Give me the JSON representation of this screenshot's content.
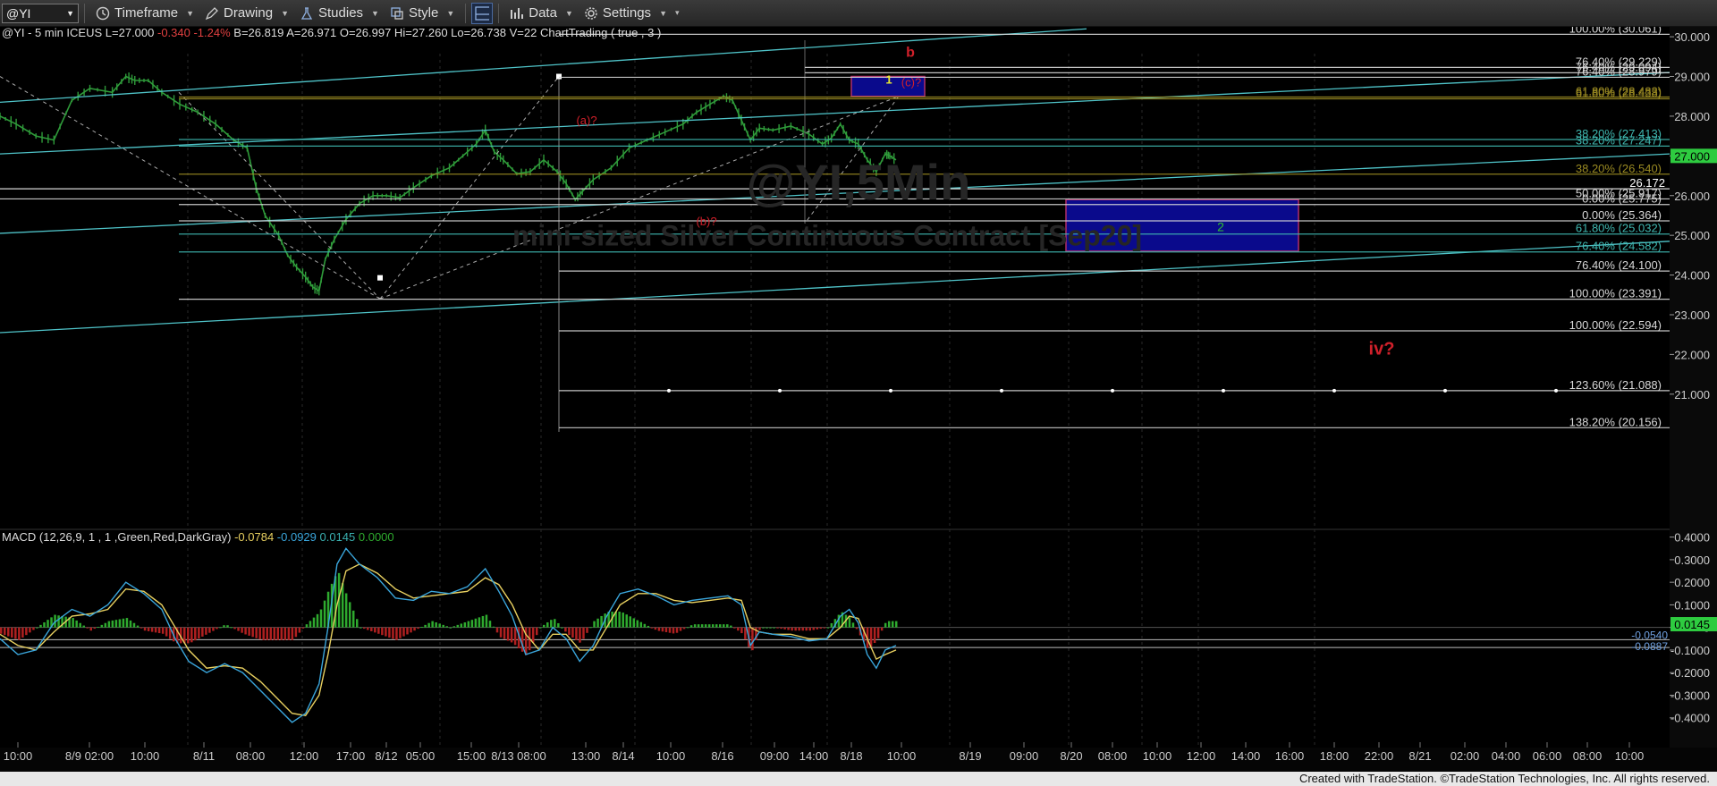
{
  "toolbar": {
    "symbol": "@YI",
    "items": [
      {
        "label": "Timeframe",
        "icon": "clock-icon"
      },
      {
        "label": "Drawing",
        "icon": "pencil-icon"
      },
      {
        "label": "Studies",
        "icon": "flask-icon"
      },
      {
        "label": "Style",
        "icon": "style-icon"
      },
      {
        "label": "Data",
        "icon": "bar-chart-icon"
      },
      {
        "label": "Settings",
        "icon": "gear-icon"
      }
    ]
  },
  "colors": {
    "background": "#000000",
    "price": "#2f9b3a",
    "fib_white": "#d8d8d8",
    "fib_teal": "#3fb7b0",
    "fib_yellow": "#9a8a22",
    "channel": "#4fc3c8",
    "box_fill": "#0a0a8c",
    "box_border": "#b0306a",
    "wave_label": "#d0202a",
    "yellow_label": "#e8e830",
    "green_label": "#30c030",
    "macd": "#3aa6dc",
    "signal": "#e8d060",
    "hist_up": "#2eaa2e",
    "hist_down": "#b02020"
  },
  "header": {
    "symbol_info": "@YI - 5 min  ICEUS",
    "last": "L=27.000",
    "change": "-0.340",
    "change_pct": "-1.24%",
    "bid": "B=26.819",
    "ask": "A=26.971",
    "open": "O=26.997",
    "high": "Hi=27.260",
    "low": "Lo=26.738",
    "volume": "V=22",
    "strategy": "ChartTrading ( true , 3 )"
  },
  "watermark": {
    "symbol": "@YI,5Min",
    "description": "mini-sized Silver Continuous Contract [Sep20]"
  },
  "price_tag": "27.000",
  "level_26172": "26.172",
  "macd_header": {
    "label": "MACD (12,26,9, 1 , 1 ,Green,Red,DarkGray)",
    "v1": "-0.0784",
    "v2": "-0.0929",
    "v3": "0.0145",
    "v4": "0.0000"
  },
  "macd_tag": "0.0145",
  "macd_lines": [
    "-0.0540",
    "-0.0887"
  ],
  "footer": "Created with TradeStation. ©TradeStation Technologies, Inc. All rights reserved.",
  "chart_data": {
    "type": "line",
    "title": "@YI - 5 min ICEUS",
    "ylim": [
      20.05,
      30.25
    ],
    "price_ticks": [
      30,
      29,
      28,
      27,
      26,
      25,
      24,
      23,
      22,
      21
    ],
    "price_tick_labels": [
      "30.000",
      "29.000",
      "28.000",
      "27.000",
      "26.000",
      "25.000",
      "24.000",
      "23.000",
      "22.000",
      "21.000"
    ],
    "x_tick_labels": [
      "10:00",
      "8/9 02:00",
      "10:00",
      "8/11",
      "08:00",
      "12:00",
      "17:00",
      "8/12",
      "05:00",
      "15:00",
      "8/13 08:00",
      "13:00",
      "8/14",
      "10:00",
      "8/16",
      "09:00",
      "14:00",
      "8/18",
      "10:00",
      "8/19",
      "09:00",
      "8/20",
      "08:00",
      "10:00",
      "12:00",
      "14:00",
      "16:00",
      "18:00",
      "22:00",
      "8/21",
      "02:00",
      "04:00",
      "06:00",
      "08:00",
      "10:00"
    ],
    "series": [
      {
        "values": [
          [
            0,
            28.0
          ],
          [
            18,
            27.8
          ],
          [
            40,
            27.5
          ],
          [
            60,
            27.4
          ],
          [
            80,
            28.4
          ],
          [
            100,
            28.7
          ],
          [
            125,
            28.6
          ],
          [
            140,
            29.0
          ],
          [
            150,
            28.9
          ],
          [
            165,
            28.9
          ],
          [
            180,
            28.6
          ],
          [
            200,
            28.3
          ],
          [
            220,
            28.1
          ],
          [
            240,
            27.8
          ],
          [
            260,
            27.4
          ],
          [
            275,
            27.2
          ],
          [
            285,
            26.2
          ],
          [
            295,
            25.5
          ],
          [
            310,
            25.0
          ],
          [
            320,
            24.5
          ],
          [
            330,
            24.2
          ],
          [
            340,
            23.95
          ],
          [
            348,
            23.7
          ],
          [
            355,
            23.6
          ],
          [
            362,
            24.4
          ],
          [
            372,
            24.9
          ],
          [
            385,
            25.4
          ],
          [
            400,
            25.8
          ],
          [
            415,
            26.0
          ],
          [
            430,
            26.0
          ],
          [
            445,
            25.95
          ],
          [
            460,
            26.2
          ],
          [
            480,
            26.5
          ],
          [
            500,
            26.7
          ],
          [
            515,
            27.0
          ],
          [
            530,
            27.3
          ],
          [
            540,
            27.65
          ],
          [
            550,
            27.1
          ],
          [
            560,
            26.9
          ],
          [
            575,
            26.55
          ],
          [
            590,
            26.6
          ],
          [
            605,
            26.9
          ],
          [
            620,
            26.6
          ],
          [
            630,
            26.3
          ],
          [
            640,
            25.9
          ],
          [
            648,
            26.1
          ],
          [
            660,
            26.4
          ],
          [
            680,
            26.7
          ],
          [
            700,
            27.2
          ],
          [
            720,
            27.4
          ],
          [
            740,
            27.6
          ],
          [
            760,
            27.8
          ],
          [
            775,
            28.1
          ],
          [
            790,
            28.3
          ],
          [
            805,
            28.5
          ],
          [
            815,
            28.4
          ],
          [
            825,
            27.9
          ],
          [
            835,
            27.4
          ],
          [
            845,
            27.7
          ],
          [
            860,
            27.65
          ],
          [
            880,
            27.75
          ],
          [
            900,
            27.55
          ],
          [
            915,
            27.3
          ],
          [
            925,
            27.45
          ],
          [
            935,
            27.8
          ],
          [
            945,
            27.4
          ],
          [
            955,
            27.3
          ],
          [
            965,
            26.9
          ],
          [
            975,
            26.6
          ],
          [
            985,
            27.05
          ],
          [
            990,
            27.0
          ],
          [
            997,
            26.9
          ]
        ]
      }
    ],
    "fib_levels": [
      {
        "label": "100.00% (30.061)",
        "value": 30.061,
        "color": "#d8d8d8"
      },
      {
        "label": "76.40% (29.229)",
        "value": 29.229,
        "color": "#d8d8d8"
      },
      {
        "label": "76.40% (29.094)",
        "value": 29.094,
        "color": "#d8d8d8"
      },
      {
        "label": "76.40% (28.979)",
        "value": 28.979,
        "color": "#d8d8d8"
      },
      {
        "label": "61.80% (28.483)",
        "value": 28.483,
        "color": "#9a8a22"
      },
      {
        "label": "61.80% (28.438)",
        "value": 28.438,
        "color": "#9a8a22"
      },
      {
        "label": "38.20% (27.413)",
        "value": 27.413,
        "color": "#3fb7b0"
      },
      {
        "label": "38.20% (27.247)",
        "value": 27.247,
        "color": "#3fb7b0"
      },
      {
        "label": "38.20% (26.540)",
        "value": 26.54,
        "color": "#9a8a22"
      },
      {
        "label": "50.00% (25.917)",
        "value": 25.917,
        "color": "#d8d8d8"
      },
      {
        "label": "0.00% (25.775)",
        "value": 25.775,
        "color": "#d8d8d8"
      },
      {
        "label": "0.00% (25.364)",
        "value": 25.364,
        "color": "#d8d8d8"
      },
      {
        "label": "61.80% (25.032)",
        "value": 25.032,
        "color": "#3fb7b0"
      },
      {
        "label": "76.40% (24.582)",
        "value": 24.582,
        "color": "#3fb7b0"
      },
      {
        "label": "76.40% (24.100)",
        "value": 24.1,
        "color": "#d8d8d8"
      },
      {
        "label": "100.00% (23.391)",
        "value": 23.391,
        "color": "#d8d8d8"
      },
      {
        "label": "100.00% (22.594)",
        "value": 22.594,
        "color": "#d8d8d8"
      },
      {
        "label": "123.60% (21.088)",
        "value": 21.088,
        "color": "#d8d8d8"
      },
      {
        "label": "138.20% (20.156)",
        "value": 20.156,
        "color": "#d8d8d8"
      }
    ],
    "wave_labels": [
      {
        "text": "b",
        "color": "#d0202a"
      },
      {
        "text": "1",
        "color": "#e8e830"
      },
      {
        "text": "(c)?",
        "color": "#d0202a"
      },
      {
        "text": "(a)?",
        "color": "#d0202a"
      },
      {
        "text": "(b)?",
        "color": "#d0202a"
      },
      {
        "text": "2",
        "color": "#30c030"
      },
      {
        "text": "iv?",
        "color": "#d0202a"
      }
    ],
    "macd": {
      "ylim": [
        -0.5,
        0.45
      ],
      "ticks": [
        0.4,
        0.3,
        0.2,
        0.1,
        0,
        -0.1,
        -0.2,
        -0.3,
        -0.4
      ],
      "tick_labels": [
        "0.4000",
        "0.3000",
        "0.2000",
        "0.1000",
        "0",
        "-0.1000",
        "-0.2000",
        "-0.3000",
        "-0.4000"
      ],
      "macd_values": [
        [
          0,
          -0.05
        ],
        [
          20,
          -0.12
        ],
        [
          40,
          -0.1
        ],
        [
          60,
          0.02
        ],
        [
          80,
          0.08
        ],
        [
          100,
          0.05
        ],
        [
          120,
          0.1
        ],
        [
          140,
          0.2
        ],
        [
          160,
          0.15
        ],
        [
          180,
          0.08
        ],
        [
          195,
          -0.05
        ],
        [
          210,
          -0.15
        ],
        [
          230,
          -0.2
        ],
        [
          250,
          -0.16
        ],
        [
          270,
          -0.2
        ],
        [
          290,
          -0.28
        ],
        [
          310,
          -0.36
        ],
        [
          325,
          -0.42
        ],
        [
          340,
          -0.38
        ],
        [
          355,
          -0.25
        ],
        [
          365,
          0.0
        ],
        [
          375,
          0.28
        ],
        [
          385,
          0.35
        ],
        [
          400,
          0.28
        ],
        [
          420,
          0.22
        ],
        [
          440,
          0.13
        ],
        [
          460,
          0.12
        ],
        [
          480,
          0.16
        ],
        [
          500,
          0.15
        ],
        [
          520,
          0.18
        ],
        [
          540,
          0.26
        ],
        [
          555,
          0.16
        ],
        [
          570,
          0.05
        ],
        [
          585,
          -0.12
        ],
        [
          600,
          -0.1
        ],
        [
          615,
          0.0
        ],
        [
          630,
          -0.05
        ],
        [
          645,
          -0.15
        ],
        [
          660,
          -0.08
        ],
        [
          675,
          0.05
        ],
        [
          690,
          0.15
        ],
        [
          710,
          0.17
        ],
        [
          730,
          0.14
        ],
        [
          750,
          0.1
        ],
        [
          770,
          0.12
        ],
        [
          790,
          0.13
        ],
        [
          810,
          0.14
        ],
        [
          825,
          0.1
        ],
        [
          835,
          -0.08
        ],
        [
          845,
          -0.02
        ],
        [
          860,
          -0.03
        ],
        [
          880,
          -0.04
        ],
        [
          900,
          -0.06
        ],
        [
          920,
          -0.05
        ],
        [
          935,
          0.05
        ],
        [
          945,
          0.08
        ],
        [
          955,
          0.02
        ],
        [
          965,
          -0.12
        ],
        [
          975,
          -0.18
        ],
        [
          985,
          -0.1
        ],
        [
          997,
          -0.08
        ]
      ],
      "signal_values": [
        [
          0,
          -0.03
        ],
        [
          20,
          -0.08
        ],
        [
          40,
          -0.1
        ],
        [
          60,
          -0.02
        ],
        [
          80,
          0.05
        ],
        [
          100,
          0.06
        ],
        [
          120,
          0.08
        ],
        [
          140,
          0.17
        ],
        [
          160,
          0.16
        ],
        [
          180,
          0.1
        ],
        [
          195,
          0.0
        ],
        [
          210,
          -0.1
        ],
        [
          230,
          -0.18
        ],
        [
          250,
          -0.17
        ],
        [
          270,
          -0.18
        ],
        [
          290,
          -0.24
        ],
        [
          310,
          -0.32
        ],
        [
          325,
          -0.38
        ],
        [
          340,
          -0.39
        ],
        [
          355,
          -0.3
        ],
        [
          365,
          -0.12
        ],
        [
          375,
          0.1
        ],
        [
          385,
          0.25
        ],
        [
          400,
          0.28
        ],
        [
          420,
          0.24
        ],
        [
          440,
          0.17
        ],
        [
          460,
          0.13
        ],
        [
          480,
          0.14
        ],
        [
          500,
          0.15
        ],
        [
          520,
          0.16
        ],
        [
          540,
          0.22
        ],
        [
          555,
          0.19
        ],
        [
          570,
          0.1
        ],
        [
          585,
          -0.03
        ],
        [
          600,
          -0.1
        ],
        [
          615,
          -0.03
        ],
        [
          630,
          -0.03
        ],
        [
          645,
          -0.1
        ],
        [
          660,
          -0.1
        ],
        [
          675,
          0.0
        ],
        [
          690,
          0.1
        ],
        [
          710,
          0.15
        ],
        [
          730,
          0.15
        ],
        [
          750,
          0.12
        ],
        [
          770,
          0.11
        ],
        [
          790,
          0.12
        ],
        [
          810,
          0.13
        ],
        [
          825,
          0.12
        ],
        [
          835,
          0.0
        ],
        [
          845,
          -0.02
        ],
        [
          860,
          -0.03
        ],
        [
          880,
          -0.03
        ],
        [
          900,
          -0.05
        ],
        [
          920,
          -0.05
        ],
        [
          935,
          0.0
        ],
        [
          945,
          0.05
        ],
        [
          955,
          0.04
        ],
        [
          965,
          -0.05
        ],
        [
          975,
          -0.14
        ],
        [
          985,
          -0.12
        ],
        [
          997,
          -0.1
        ]
      ]
    }
  }
}
